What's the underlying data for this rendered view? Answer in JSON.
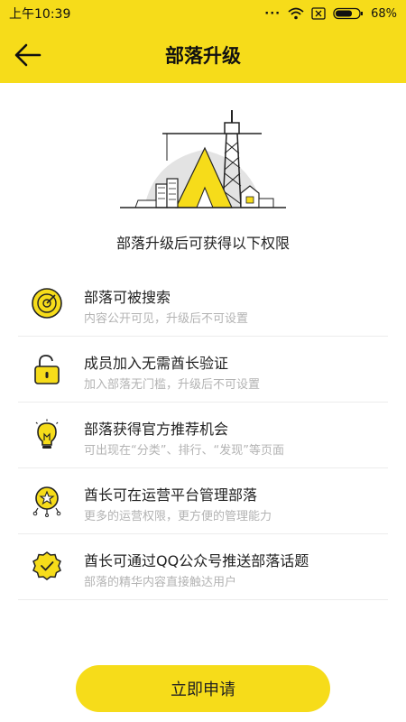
{
  "status": {
    "time": "上午10:39",
    "battery": "68%"
  },
  "header": {
    "title": "部落升级"
  },
  "intro": "部落升级后可获得以下权限",
  "permissions": [
    {
      "title": "部落可被搜索",
      "desc": "内容公开可见，升级后不可设置"
    },
    {
      "title": "成员加入无需酋长验证",
      "desc": "加入部落无门槛，升级后不可设置"
    },
    {
      "title": "部落获得官方推荐机会",
      "desc": "可出现在“分类”、排行、“发现”等页面"
    },
    {
      "title": "酋长可在运营平台管理部落",
      "desc": "更多的运营权限，更方便的管理能力"
    },
    {
      "title": "酋长可通过QQ公众号推送部落话题",
      "desc": "部落的精华内容直接触达用户"
    }
  ],
  "apply_label": "立即申请",
  "colors": {
    "accent": "#f6dc1a",
    "text": "#222222",
    "muted": "#b3b3b3"
  },
  "icons": [
    "back-arrow-icon",
    "wifi-icon",
    "sim-icon",
    "battery-icon",
    "radar-icon",
    "unlock-icon",
    "lightbulb-icon",
    "star-badge-icon",
    "check-badge-icon"
  ]
}
